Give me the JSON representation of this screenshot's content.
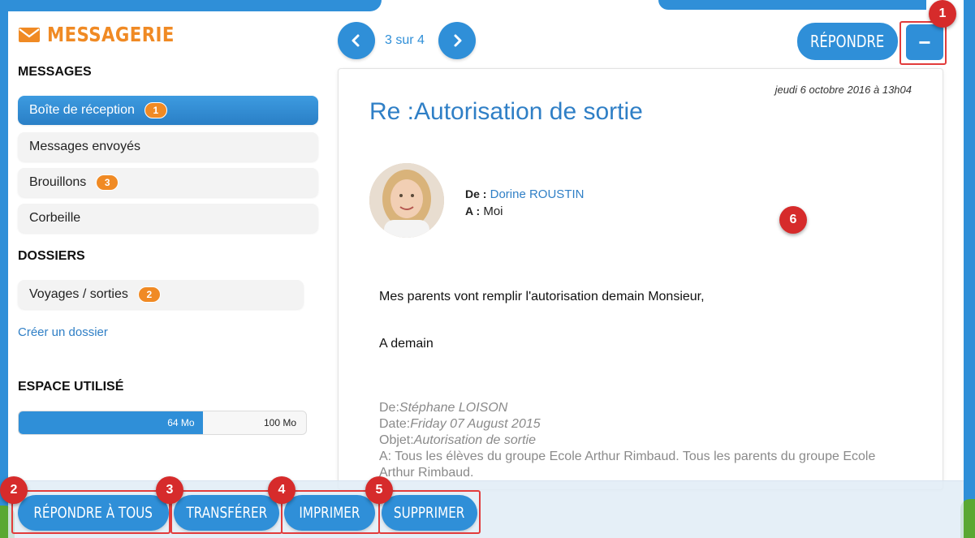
{
  "app": {
    "title": "MESSAGERIE",
    "accent_color": "#2f8fd8",
    "brand_color": "#f08a24"
  },
  "sidebar": {
    "messages_heading": "MESSAGES",
    "items": [
      {
        "label": "Boîte de réception",
        "badge": "1",
        "active": true
      },
      {
        "label": "Messages envoyés",
        "badge": "",
        "active": false
      },
      {
        "label": "Brouillons",
        "badge": "3",
        "active": false
      },
      {
        "label": "Corbeille",
        "badge": "",
        "active": false
      }
    ],
    "folders_heading": "DOSSIERS",
    "folders": [
      {
        "label": "Voyages / sorties",
        "badge": "2"
      }
    ],
    "create_folder_link": "Créer un dossier",
    "storage_heading": "ESPACE UTILISÉ",
    "storage_used_label": "64 Mo",
    "storage_total_label": "100 Mo",
    "storage_used_fraction": 0.64
  },
  "pager": {
    "text": "3 sur 4",
    "prev_icon": "chevron-left-icon",
    "next_icon": "chevron-right-icon"
  },
  "toolbar": {
    "reply_label": "RÉPONDRE",
    "collapse_label": "−"
  },
  "message": {
    "date": "jeudi 6 octobre 2016 à 13h04",
    "subject": "Re :Autorisation de sortie",
    "from_label": "De :",
    "from_name": "Dorine ROUSTIN",
    "to_label": "A :",
    "to_name": "Moi",
    "body_line1": "Mes parents vont remplir l'autorisation demain Monsieur,",
    "body_line2": "A demain",
    "quoted": {
      "from_label": "De:",
      "from_value": "Stéphane LOISON",
      "date_label": "Date:",
      "date_value": "Friday 07 August 2015",
      "subject_label": "Objet:",
      "subject_value": "Autorisation de sortie",
      "to_line": "A: Tous les élèves du groupe Ecole Arthur Rimbaud. Tous les parents du groupe Ecole Arthur Rimbaud."
    }
  },
  "actions": {
    "reply_all": "RÉPONDRE À TOUS",
    "forward": "TRANSFÉRER",
    "print": "IMPRIMER",
    "delete": "SUPPRIMER"
  },
  "annotations": {
    "m1": "1",
    "m2": "2",
    "m3": "3",
    "m4": "4",
    "m5": "5",
    "m6": "6"
  }
}
